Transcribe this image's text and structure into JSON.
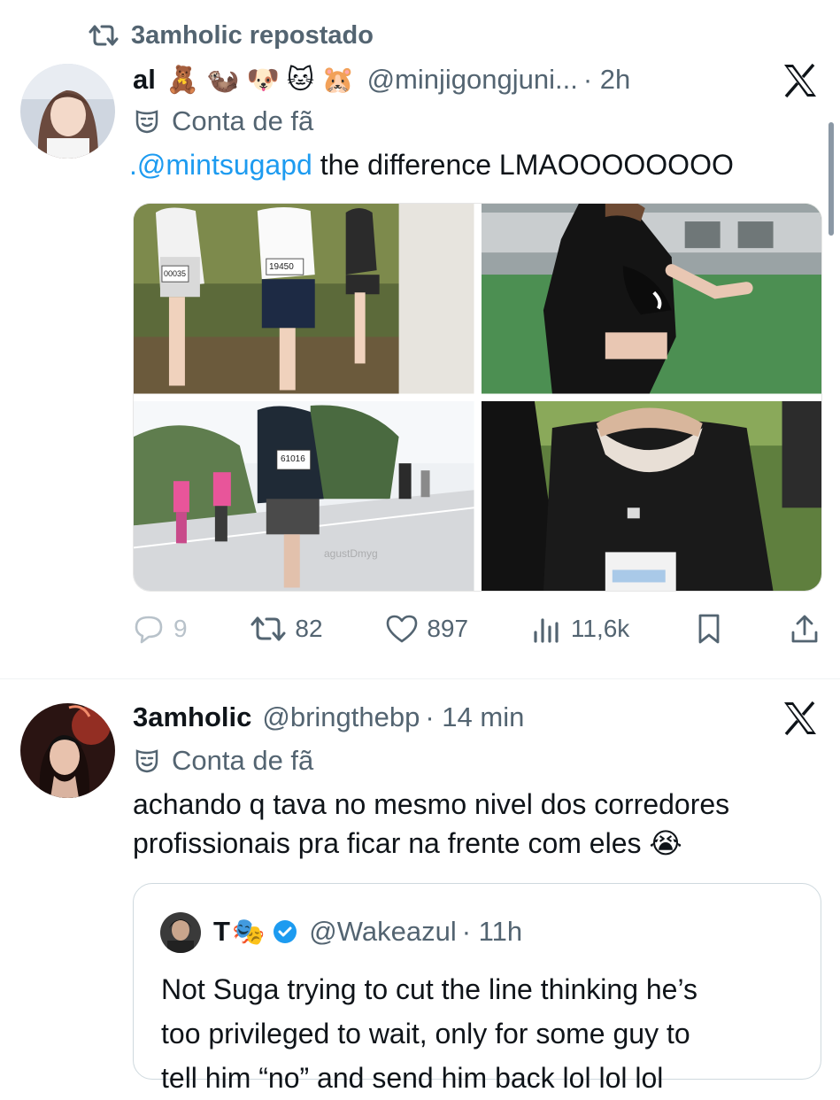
{
  "repost": {
    "text": "3amholic repostado"
  },
  "post1": {
    "name": "al",
    "emojis": "🧸🦦🐶🐱🐹",
    "handle": "@minjigongjuni...",
    "time": "· 2h",
    "badge": "Conta de fã",
    "mention": ".@mintsugapd",
    "text": " the difference LMAOOOOOOOO",
    "watermark": "agustDmyg",
    "bibs": [
      "00035",
      "19450",
      "61016"
    ],
    "stats": {
      "replies": "9",
      "reposts": "82",
      "likes": "897",
      "views": "11,6k"
    }
  },
  "post2": {
    "name": "3amholic",
    "handle": "@bringthebp",
    "time": "· 14 min",
    "badge": "Conta de fã",
    "text_line1": "achando q tava no mesmo nivel dos corredores",
    "text_line2": "profissionais pra ficar na frente com eles 😭"
  },
  "quote": {
    "name": "T",
    "name_emoji": "🎭",
    "handle": "@Wakeazul",
    "time": "· 11h",
    "line1": "Not Suga trying to cut the line thinking he’s",
    "line2": "too privileged to wait, only for some guy to",
    "line3": "tell him “no” and send him back lol lol lol"
  },
  "colors": {
    "accent": "#1d9bf0",
    "muted": "#536471",
    "verified": "#1d9bf0"
  },
  "icons": [
    "repost-icon",
    "x-logo-icon",
    "theater-mask-icon",
    "reply-icon",
    "like-icon",
    "views-icon",
    "bookmark-icon",
    "share-icon",
    "verified-icon"
  ]
}
